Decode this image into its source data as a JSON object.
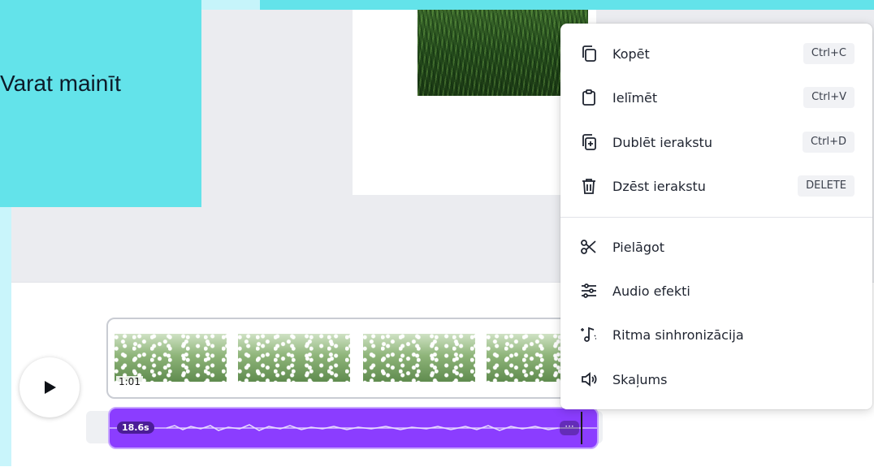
{
  "callout": {
    "text": "Varat mainīt"
  },
  "timeline": {
    "video_clip": {
      "duration": "1:01"
    },
    "audio_clip": {
      "duration": "18.6s",
      "more_label": "···"
    }
  },
  "context_menu": {
    "items": [
      {
        "label": "Kopēt",
        "shortcut": "Ctrl+C",
        "icon": "copy-icon"
      },
      {
        "label": "Ielīmēt",
        "shortcut": "Ctrl+V",
        "icon": "paste-icon"
      },
      {
        "label": "Dublēt ierakstu",
        "shortcut": "Ctrl+D",
        "icon": "duplicate-icon"
      },
      {
        "label": "Dzēst ierakstu",
        "shortcut": "DELETE",
        "icon": "trash-icon"
      },
      {
        "label": "Pielāgot",
        "icon": "scissors-icon"
      },
      {
        "label": "Audio efekti",
        "icon": "sliders-icon"
      },
      {
        "label": "Ritma sinhronizācija",
        "icon": "beat-sync-icon"
      },
      {
        "label": "Skaļums",
        "icon": "volume-icon"
      }
    ]
  },
  "colors": {
    "callout_bg": "#63e3ea",
    "audio_accent": "#8b3dff",
    "audio_label_bg": "#4b1d96"
  }
}
